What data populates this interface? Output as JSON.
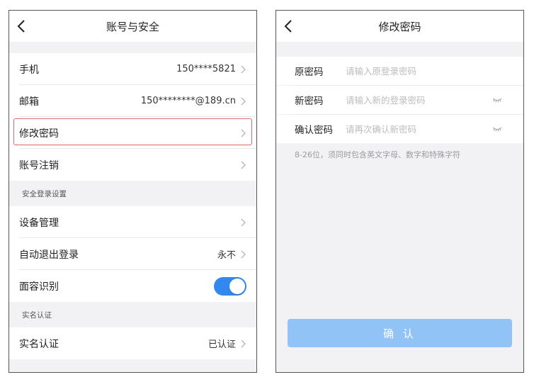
{
  "left": {
    "title": "账号与安全",
    "rows": [
      {
        "label": "手机",
        "value": "150****5821"
      },
      {
        "label": "邮箱",
        "value": "150********@189.cn"
      },
      {
        "label": "修改密码",
        "value": ""
      },
      {
        "label": "账号注销",
        "value": ""
      }
    ],
    "section_login": "安全登录设置",
    "login_rows": [
      {
        "label": "设备管理",
        "value": ""
      },
      {
        "label": "自动退出登录",
        "value": "永不"
      },
      {
        "label": "面容识别",
        "value": ""
      }
    ],
    "face_id_enabled": true,
    "section_realname": "实名认证",
    "realname_row": {
      "label": "实名认证",
      "value": "已认证"
    }
  },
  "right": {
    "title": "修改密码",
    "fields": [
      {
        "label": "原密码",
        "placeholder": "请输入原登录密码",
        "value": ""
      },
      {
        "label": "新密码",
        "placeholder": "请输入新的登录密码",
        "value": ""
      },
      {
        "label": "确认密码",
        "placeholder": "请再次确认新密码",
        "value": ""
      }
    ],
    "hint": "8-26位，须同时包含英文字母、数字和特殊字符",
    "confirm_label": "确 认"
  },
  "colors": {
    "accent": "#3388f0",
    "highlight_border": "#e06a6a",
    "confirm_button": "#92c3f7",
    "background": "#f2f2f4"
  },
  "icons": [
    "back-arrow-icon",
    "chevron-right-icon",
    "eye-closed-icon"
  ]
}
